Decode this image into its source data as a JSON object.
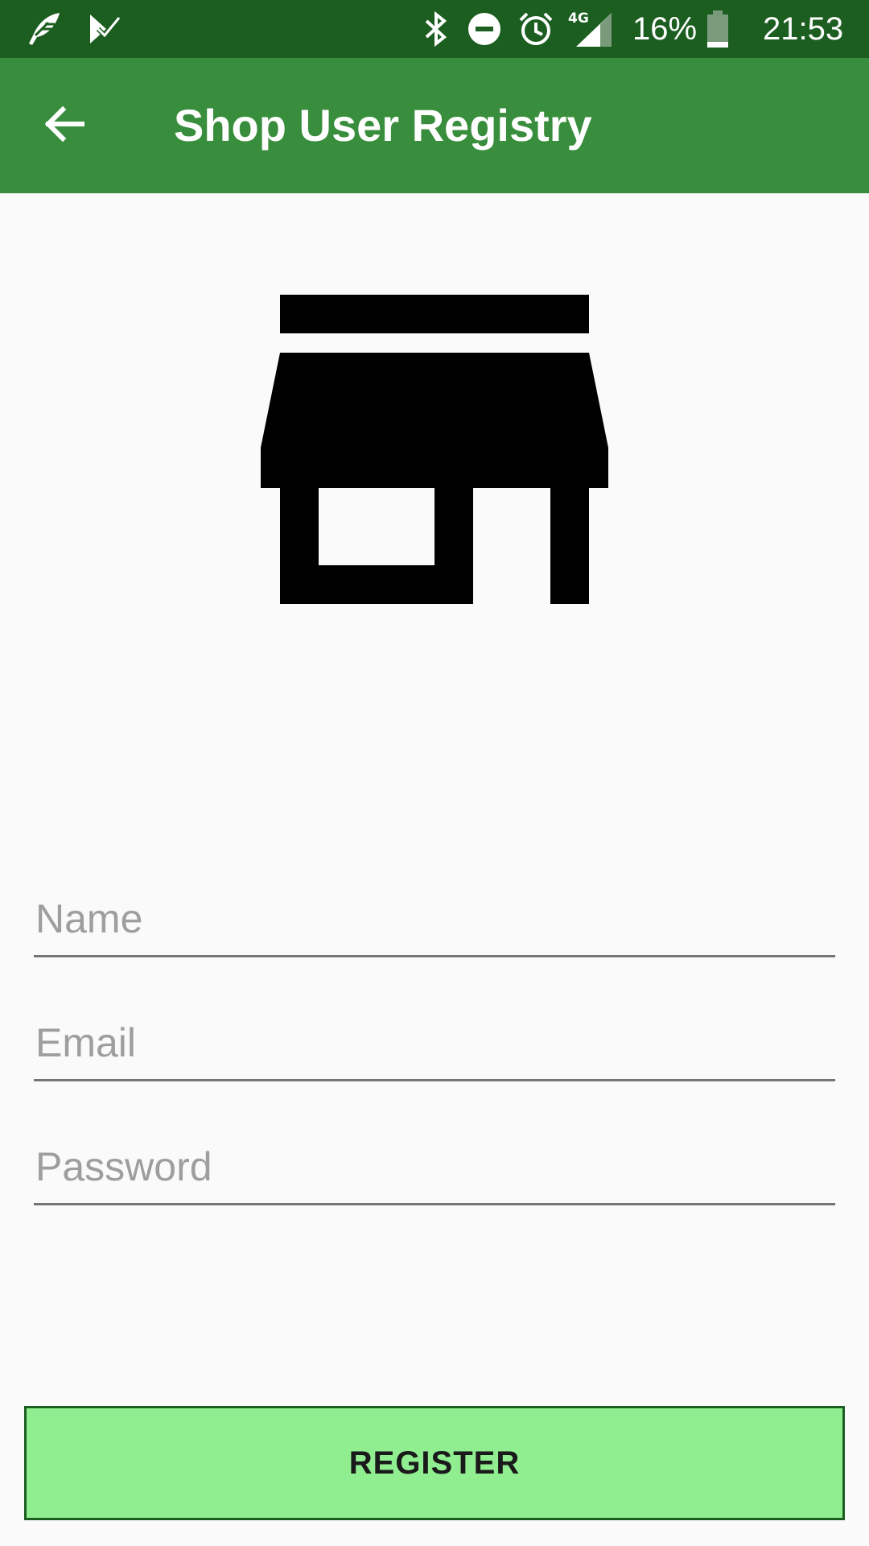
{
  "status_bar": {
    "left_icons": [
      "feather-app-icon",
      "checkmark-app-icon"
    ],
    "right_icons": [
      "bluetooth-icon",
      "do-not-disturb-icon",
      "alarm-icon",
      "signal-4g-icon",
      "battery-icon"
    ],
    "network_label": "4G",
    "battery_percent": "16%",
    "time": "21:53",
    "background_color": "#1b5e20"
  },
  "app_bar": {
    "back_icon": "arrow-back-icon",
    "title": "Shop User Registry",
    "background_color": "#388e3c"
  },
  "hero": {
    "icon": "store-icon"
  },
  "form": {
    "name": {
      "placeholder": "Name",
      "value": ""
    },
    "email": {
      "placeholder": "Email",
      "value": ""
    },
    "password": {
      "placeholder": "Password",
      "value": ""
    }
  },
  "register_button": {
    "label": "REGISTER",
    "background_color": "#90ee90",
    "border_color": "#1b5e20"
  }
}
